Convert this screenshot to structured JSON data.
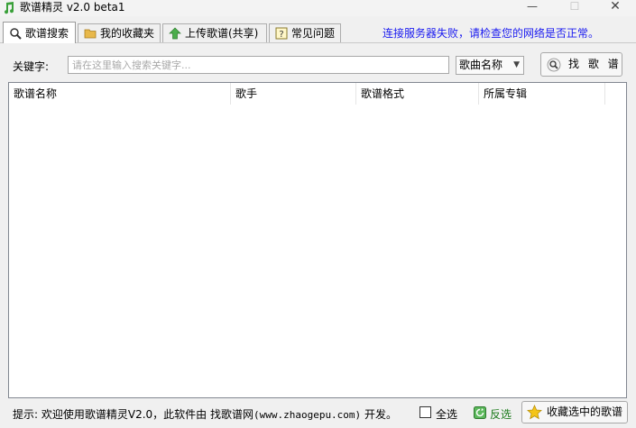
{
  "window": {
    "title": "歌谱精灵 v2.0 beta1",
    "min_glyph": "—",
    "max_glyph": "☐",
    "close_glyph": "✕"
  },
  "tabs": [
    {
      "label": "歌谱搜索",
      "icon": "magnifier-icon",
      "active": true
    },
    {
      "label": "我的收藏夹",
      "icon": "folder-icon",
      "active": false
    },
    {
      "label": "上传歌谱(共享)",
      "icon": "upload-arrow-icon",
      "active": false
    },
    {
      "label": "常见问题",
      "icon": "question-icon",
      "active": false
    }
  ],
  "status_message": "连接服务器失败，请检查您的网络是否正常。",
  "search": {
    "keyword_label": "关键字:",
    "placeholder": "请在这里输入搜索关键字...",
    "field_selected": "歌曲名称",
    "button_label": "找 歌 谱"
  },
  "table": {
    "columns": [
      "歌谱名称",
      "歌手",
      "歌谱格式",
      "所属专辑"
    ],
    "rows": []
  },
  "footer": {
    "hint_prefix": "提示: 欢迎使用歌谱精灵V2.0，此软件由 找歌谱网",
    "hint_url": "(www.zhaogepu.com)",
    "hint_suffix": " 开发。",
    "select_all_label": "全选",
    "invert_label": "反选",
    "collect_button_label": "收藏选中的歌谱"
  },
  "colors": {
    "status_link": "#1a1af0",
    "invert_green": "#1a7a1a",
    "app_icon": "#3aa03a"
  }
}
